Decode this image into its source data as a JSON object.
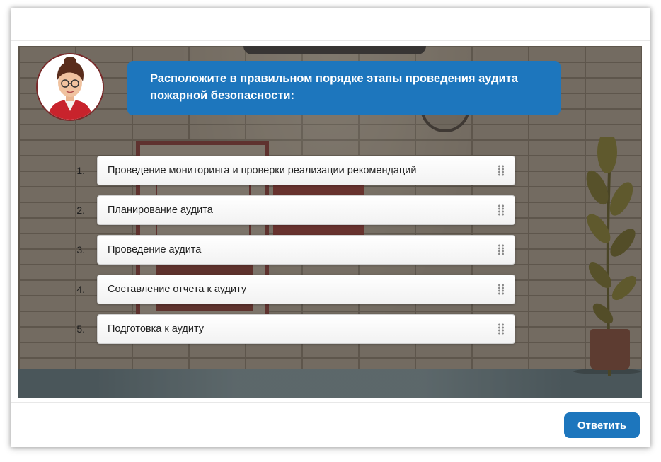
{
  "quiz": {
    "question": "Расположите в правильном порядке этапы проведения аудита пожарной безопасности:",
    "items": [
      {
        "number": "1.",
        "label": "Проведение мониторинга и проверки реализации рекомендаций"
      },
      {
        "number": "2.",
        "label": "Планирование аудита"
      },
      {
        "number": "3.",
        "label": "Проведение аудита"
      },
      {
        "number": "4.",
        "label": "Составление отчета к аудиту"
      },
      {
        "number": "5.",
        "label": "Подготовка к аудиту"
      }
    ]
  },
  "footer": {
    "submit_label": "Ответить"
  },
  "colors": {
    "accent": "#1d76bd",
    "item_background": "#ffffff",
    "wall": "#8f877b",
    "floor": "#4d6570"
  },
  "icons": {
    "avatar": "presenter-avatar",
    "drag": "drag-handle-icon"
  }
}
